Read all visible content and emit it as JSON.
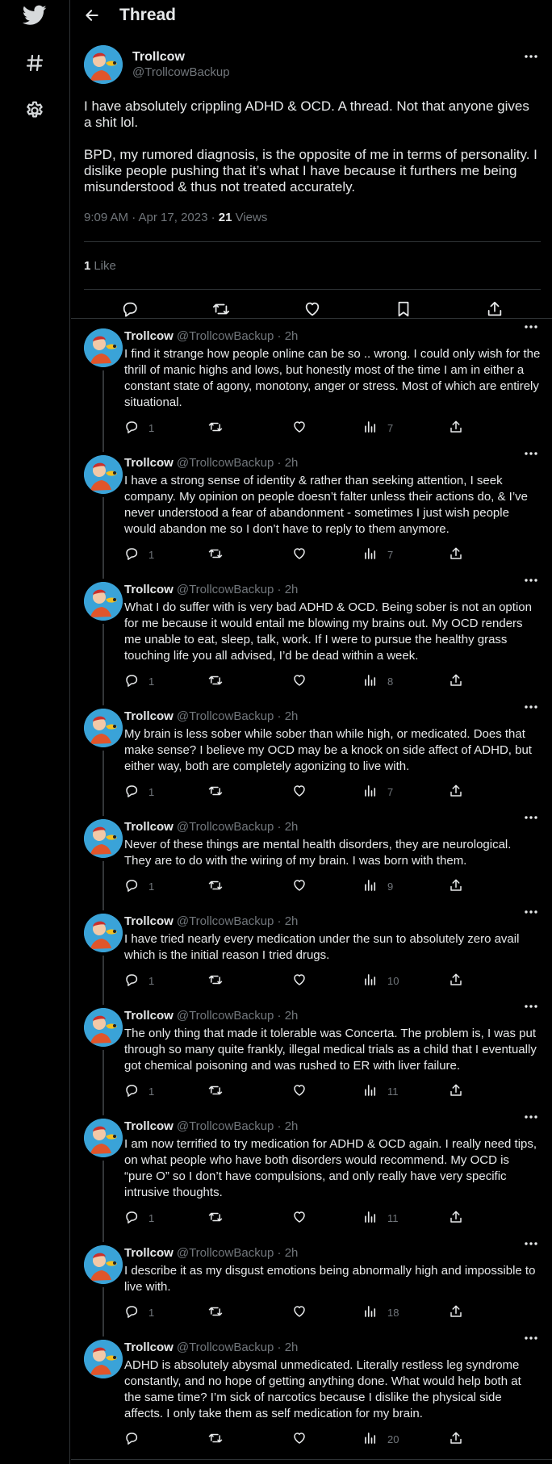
{
  "header": {
    "title": "Thread"
  },
  "sidebar": {
    "icons": [
      "twitter-bird-icon",
      "hashtag-icon",
      "gear-icon"
    ]
  },
  "colors": {
    "background": "#000000",
    "text": "#e7e9ea",
    "muted": "#71767b",
    "border": "#2f3336",
    "brand": "#1d9bf0"
  },
  "focal": {
    "name": "Trollcow",
    "handle": "@TrollcowBackup",
    "text": "I have absolutely crippling ADHD & OCD. A thread. Not that anyone gives a shit lol.\n\nBPD, my rumored diagnosis, is the opposite of me in terms of personality. I dislike people pushing that it’s what I have because it furthers me being misunderstood & thus not treated accurately.",
    "time": "9:09 AM · Apr 17, 2023 · ",
    "views_count": "21",
    "views_label": " Views",
    "likes_count": "1",
    "likes_label": "Like"
  },
  "replies": [
    {
      "name": "Trollcow",
      "handle": "@TrollcowBackup · 2h",
      "text": "I find it strange how people online can be so .. wrong. I could only wish for the thrill of manic highs and lows, but honestly most of the time I am in either a constant state of agony, monotony, anger or stress. Most of which are entirely situational.",
      "replies": "1",
      "views": "7"
    },
    {
      "name": "Trollcow",
      "handle": "@TrollcowBackup · 2h",
      "text": "I have a strong sense of identity & rather than seeking attention, I seek company. My opinion on people doesn’t falter unless their actions do, & I’ve never understood a fear of abandonment - sometimes I just wish people would abandon me so I don’t have to reply to them anymore.",
      "replies": "1",
      "views": "7"
    },
    {
      "name": "Trollcow",
      "handle": "@TrollcowBackup · 2h",
      "text": "What I do suffer with is very bad ADHD & OCD. Being sober is not an option for me because it would entail me blowing my brains out. My OCD renders me unable to eat, sleep, talk, work. If I were to pursue the healthy grass touching life you all advised, I’d be dead within a week.",
      "replies": "1",
      "views": "8"
    },
    {
      "name": "Trollcow",
      "handle": "@TrollcowBackup · 2h",
      "text": "My brain is less sober while sober than while high, or medicated. Does that make sense? I believe my OCD may be a knock on side affect of ADHD, but either way, both are completely agonizing to live with.",
      "replies": "1",
      "views": "7"
    },
    {
      "name": "Trollcow",
      "handle": "@TrollcowBackup · 2h",
      "text": "Never of these things are mental health disorders, they are neurological. They are to do with the wiring of my brain. I was born with them.",
      "replies": "1",
      "views": "9"
    },
    {
      "name": "Trollcow",
      "handle": "@TrollcowBackup · 2h",
      "text": "I have tried nearly every medication under the sun to absolutely zero avail which is the initial reason I tried drugs.",
      "replies": "1",
      "views": "10"
    },
    {
      "name": "Trollcow",
      "handle": "@TrollcowBackup · 2h",
      "text": "The only thing that made it tolerable was Concerta. The problem is, I was put through so many quite frankly, illegal medical trials as a child that I eventually got chemical poisoning and was rushed to ER with liver failure.",
      "replies": "1",
      "views": "11"
    },
    {
      "name": "Trollcow",
      "handle": "@TrollcowBackup · 2h",
      "text": "I am now terrified to try medication for ADHD & OCD again. I really need tips, on what people who have both disorders would recommend. My OCD is “pure O” so I don’t have compulsions, and only really have very specific intrusive thoughts.",
      "replies": "1",
      "views": "11"
    },
    {
      "name": "Trollcow",
      "handle": "@TrollcowBackup · 2h",
      "text": "I describe it as my disgust emotions being abnormally high and impossible to live with.",
      "replies": "1",
      "views": "18"
    },
    {
      "name": "Trollcow",
      "handle": "@TrollcowBackup · 2h",
      "text": "ADHD is absolutely abysmal unmedicated. Literally restless leg syndrome constantly, and no hope of getting anything done. What would help both at the same time? I’m sick of narcotics because I dislike the physical side affects. I only take them as self medication for my brain.",
      "replies": "",
      "views": "20"
    }
  ]
}
